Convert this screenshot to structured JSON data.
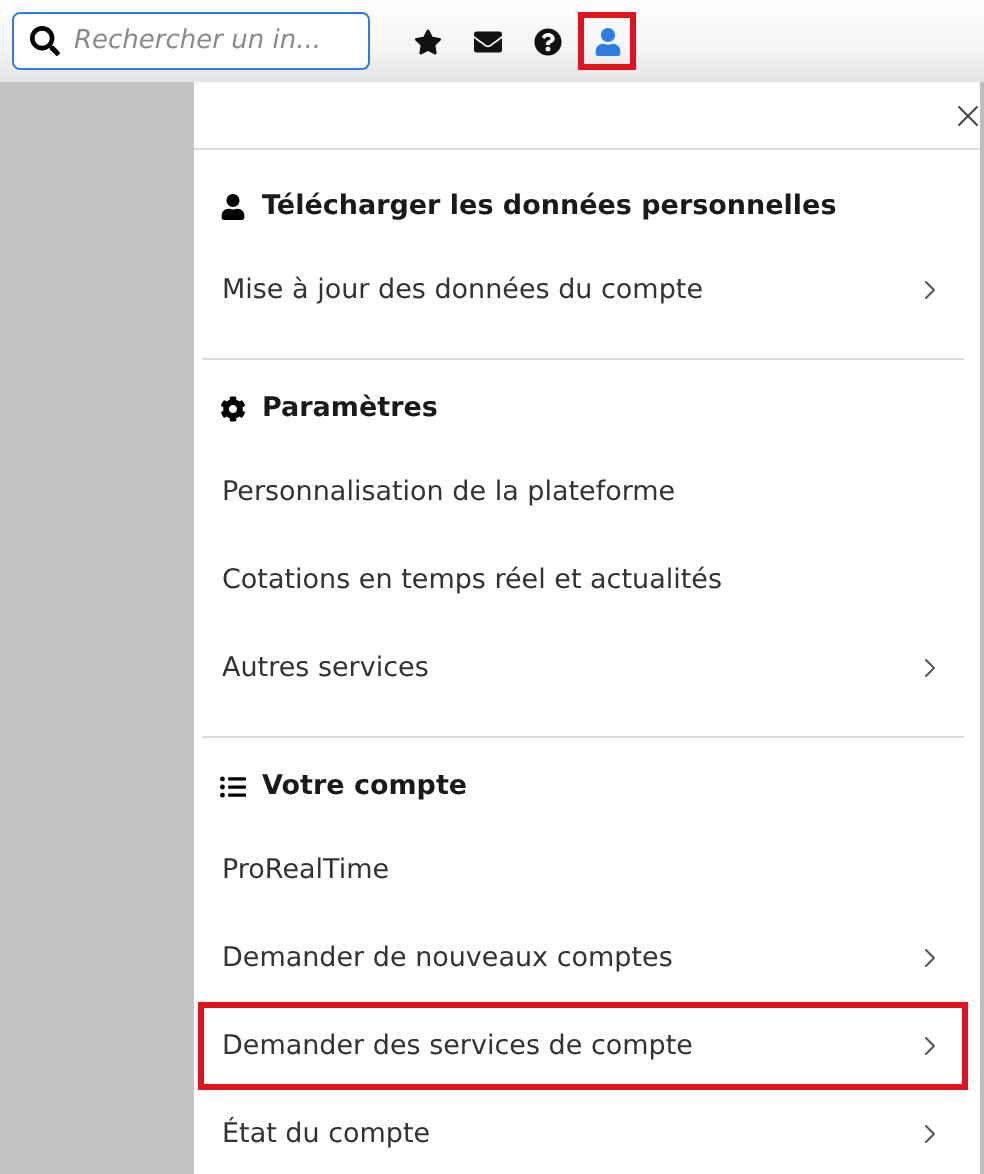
{
  "toolbar": {
    "search": {
      "placeholder": "Rechercher un in..."
    },
    "icons": [
      {
        "kind": "star",
        "selected": false,
        "highlighted": false
      },
      {
        "kind": "mail",
        "selected": false,
        "highlighted": false
      },
      {
        "kind": "help",
        "selected": false,
        "highlighted": false
      },
      {
        "kind": "user",
        "selected": true,
        "highlighted": true
      }
    ]
  },
  "panel": {
    "sections": [
      {
        "title": "Télécharger les données personnelles",
        "items": [
          {
            "label": "Mise à jour des données du compte",
            "has_arrow": true,
            "highlighted": false
          }
        ]
      },
      {
        "title": "Paramètres",
        "items": [
          {
            "label": "Personnalisation de la plateforme",
            "has_arrow": false,
            "highlighted": false
          },
          {
            "label": "Cotations en temps réel et actualités",
            "has_arrow": false,
            "highlighted": false
          },
          {
            "label": "Autres services",
            "has_arrow": true,
            "highlighted": false
          }
        ]
      },
      {
        "title": "Votre compte",
        "items": [
          {
            "label": "ProRealTime",
            "has_arrow": false,
            "highlighted": false
          },
          {
            "label": "Demander de nouveaux comptes",
            "has_arrow": true,
            "highlighted": false
          },
          {
            "label": "Demander des services de compte",
            "has_arrow": true,
            "highlighted": true
          },
          {
            "label": "État du compte",
            "has_arrow": true,
            "highlighted": false
          }
        ]
      }
    ]
  }
}
